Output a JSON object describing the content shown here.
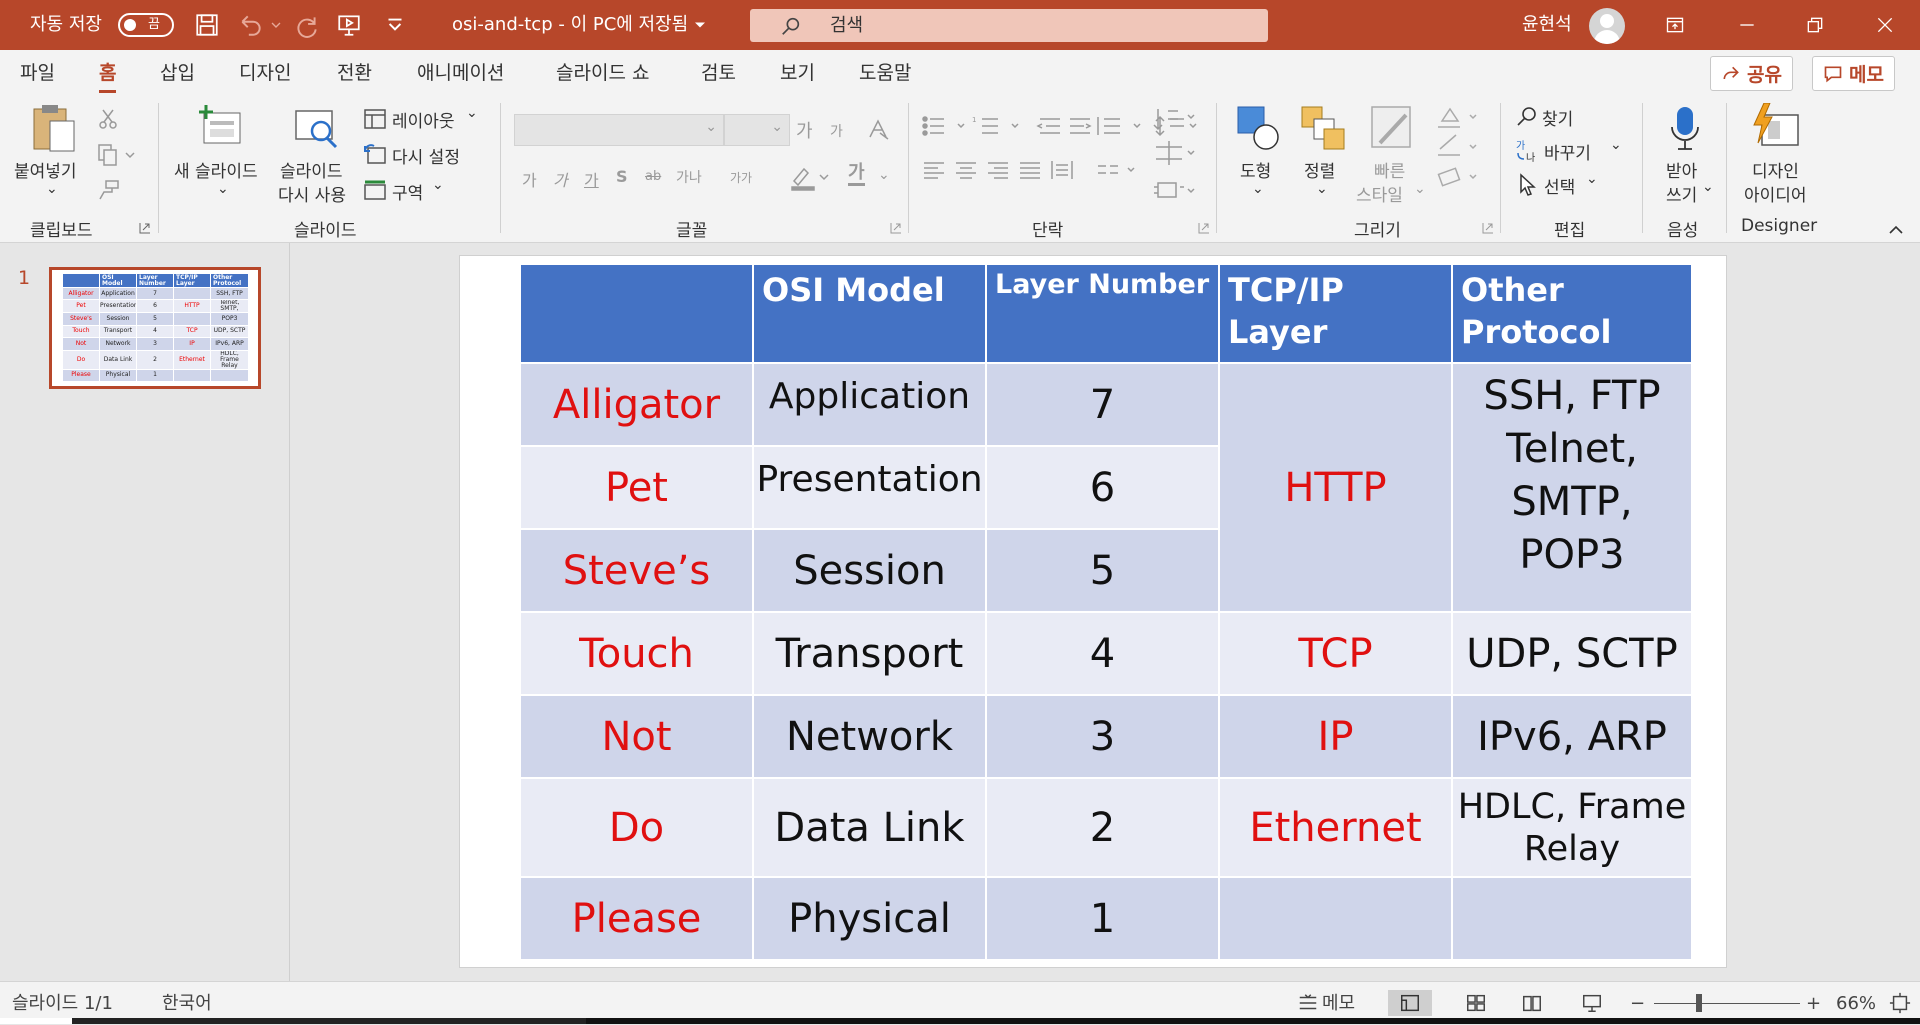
{
  "titlebar": {
    "autosave_label": "자동 저장",
    "autosave_state": "끔",
    "doc_title": "osi-and-tcp  -  이 PC에 저장됨",
    "search_placeholder": "검색",
    "user_name": "윤현석"
  },
  "menu": {
    "items": [
      "파일",
      "홈",
      "삽입",
      "디자인",
      "전환",
      "애니메이션",
      "슬라이드 쇼",
      "검토",
      "보기",
      "도움말"
    ],
    "active": "홈",
    "share_label": "공유",
    "memo_label": "메모"
  },
  "ribbon": {
    "clipboard": {
      "paste": "붙여넣기",
      "group": "클립보드"
    },
    "slides": {
      "new_slide": "새 슬라이드",
      "reuse_1": "슬라이드",
      "reuse_2": "다시 사용",
      "layout": "레이아웃",
      "reset": "다시 설정",
      "section": "구역",
      "group": "슬라이드"
    },
    "font": {
      "group": "글꼴",
      "grow": "가",
      "shrink": "가",
      "bold": "가",
      "italic": "가",
      "underline": "가",
      "strike": "S",
      "spacing": "가나",
      "case": "가가",
      "color": "가"
    },
    "paragraph": {
      "group": "단락"
    },
    "drawing": {
      "shapes": "도형",
      "arrange": "정렬",
      "quick_1": "빠른",
      "quick_2": "스타일",
      "group": "그리기"
    },
    "editing": {
      "find": "찾기",
      "replace": "바꾸기",
      "select": "선택",
      "group": "편집"
    },
    "voice": {
      "dictate_1": "받아",
      "dictate_2": "쓰기",
      "group": "음성"
    },
    "designer": {
      "label_1": "디자인",
      "label_2": "아이디어",
      "group": "Designer"
    }
  },
  "thumbnail": {
    "number": "1",
    "headers": [
      "",
      "OSI Model",
      "Layer Number",
      "TCP/IP Layer",
      "Other Protocol"
    ],
    "rows": [
      [
        "Alligator",
        "Application",
        "7",
        "",
        "SSH, FTP"
      ],
      [
        "Pet",
        "Presentation",
        "6",
        "HTTP",
        "Telnet, SMTP,"
      ],
      [
        "Steve's",
        "Session",
        "5",
        "",
        "POP3"
      ],
      [
        "Touch",
        "Transport",
        "4",
        "TCP",
        "UDP, SCTP"
      ],
      [
        "Not",
        "Network",
        "3",
        "IP",
        "IPv6, ARP"
      ],
      [
        "Do",
        "Data Link",
        "2",
        "Ethernet",
        "HDLC, Frame Relay"
      ],
      [
        "Please",
        "Physical",
        "1",
        "",
        ""
      ]
    ]
  },
  "slide_table": {
    "headers": [
      "",
      "OSI Model",
      "Layer Number",
      "TCP/IP Layer",
      "Other Protocol"
    ],
    "mnemonic": [
      "Alligator",
      "Pet",
      "Steve’s",
      "Touch",
      "Not",
      "Do",
      "Please"
    ],
    "osi": [
      "Application",
      "Presentation",
      "Session",
      "Transport",
      "Network",
      "Data Link",
      "Physical"
    ],
    "layer": [
      "7",
      "6",
      "5",
      "4",
      "3",
      "2",
      "1"
    ],
    "tcpip": {
      "upper": "HTTP",
      "transport": "TCP",
      "network": "IP",
      "link": "Ethernet",
      "physical": ""
    },
    "other": {
      "upper": "SSH, FTP Telnet, SMTP, POP3",
      "transport": "UDP, SCTP",
      "network": "IPv6, ARP",
      "link": "HDLC, Frame Relay",
      "physical": ""
    }
  },
  "statusbar": {
    "slide_info": "슬라이드 1/1",
    "language": "한국어",
    "notes": "메모",
    "zoom": "66%",
    "minus": "−",
    "plus": "+"
  },
  "colors": {
    "accent": "#b7472a",
    "table_header": "#4472c4",
    "row_dark": "#cfd5ea",
    "row_light": "#e9ebf5",
    "mnemonic_red": "#e01010"
  }
}
